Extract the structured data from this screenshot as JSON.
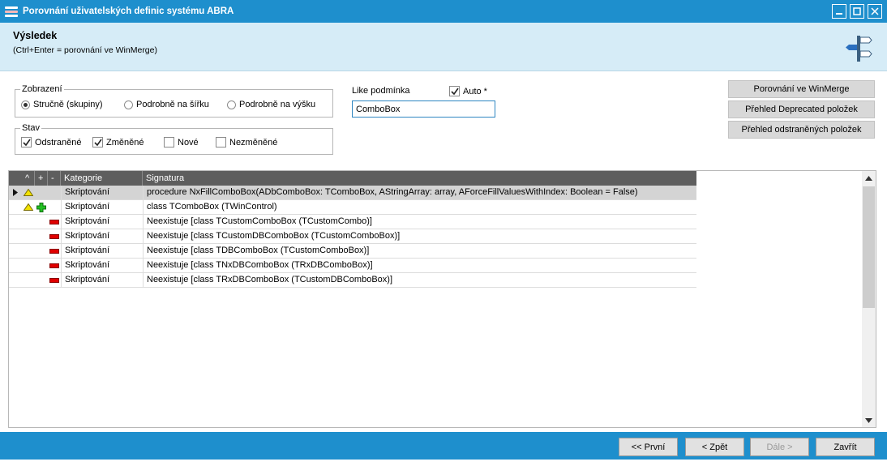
{
  "window": {
    "title": "Porovnání uživatelských definic systému ABRA"
  },
  "header": {
    "title": "Výsledek",
    "subtitle": "(Ctrl+Enter = porovnání ve WinMerge)"
  },
  "zobrazeni": {
    "legend": "Zobrazení",
    "options": [
      "Stručně (skupiny)",
      "Podrobně na šířku",
      "Podrobně na výšku"
    ],
    "selected": "Stručně (skupiny)"
  },
  "stav": {
    "legend": "Stav",
    "options": [
      {
        "label": "Odstraněné",
        "checked": true
      },
      {
        "label": "Změněné",
        "checked": true
      },
      {
        "label": "Nové",
        "checked": false
      },
      {
        "label": "Nezměněné",
        "checked": false
      }
    ]
  },
  "like": {
    "label": "Like podmínka",
    "auto_label": "Auto *",
    "auto_checked": true,
    "value": "ComboBox"
  },
  "right_buttons": {
    "winmerge": "Porovnání ve WinMerge",
    "deprecated": "Přehled Deprecated položek",
    "removed": "Přehled odstraněných položek"
  },
  "grid": {
    "columns": {
      "up": "^",
      "plus": "+",
      "minus": "-",
      "category": "Kategorie",
      "signature": "Signatura"
    },
    "rows": [
      {
        "status": "changed",
        "selected": true,
        "category": "Skriptování",
        "signature": "procedure NxFillComboBox(ADbComboBox: TComboBox, AStringArray: array, AForceFillValuesWithIndex: Boolean = False)"
      },
      {
        "status": "changed-added",
        "selected": false,
        "category": "Skriptování",
        "signature": "class TComboBox (TWinControl)"
      },
      {
        "status": "removed",
        "selected": false,
        "category": "Skriptování",
        "signature": "Neexistuje [class TCustomComboBox (TCustomCombo)]"
      },
      {
        "status": "removed",
        "selected": false,
        "category": "Skriptování",
        "signature": "Neexistuje [class TCustomDBComboBox (TCustomComboBox)]"
      },
      {
        "status": "removed",
        "selected": false,
        "category": "Skriptování",
        "signature": "Neexistuje [class TDBComboBox (TCustomComboBox)]"
      },
      {
        "status": "removed",
        "selected": false,
        "category": "Skriptování",
        "signature": "Neexistuje [class TNxDBComboBox (TRxDBComboBox)]"
      },
      {
        "status": "removed",
        "selected": false,
        "category": "Skriptování",
        "signature": "Neexistuje [class TRxDBComboBox (TCustomDBComboBox)]"
      }
    ]
  },
  "footer": {
    "first": "<< První",
    "back": "< Zpět",
    "next": "Dále >",
    "close": "Zavřít"
  },
  "colors": {
    "titlebar": "#1e8fcd",
    "header_bg": "#d6ecf7",
    "grid_header": "#5e5e5e",
    "removed_marker": "#e00000",
    "added_marker": "#22c022",
    "changed_marker": "#f2e200"
  }
}
